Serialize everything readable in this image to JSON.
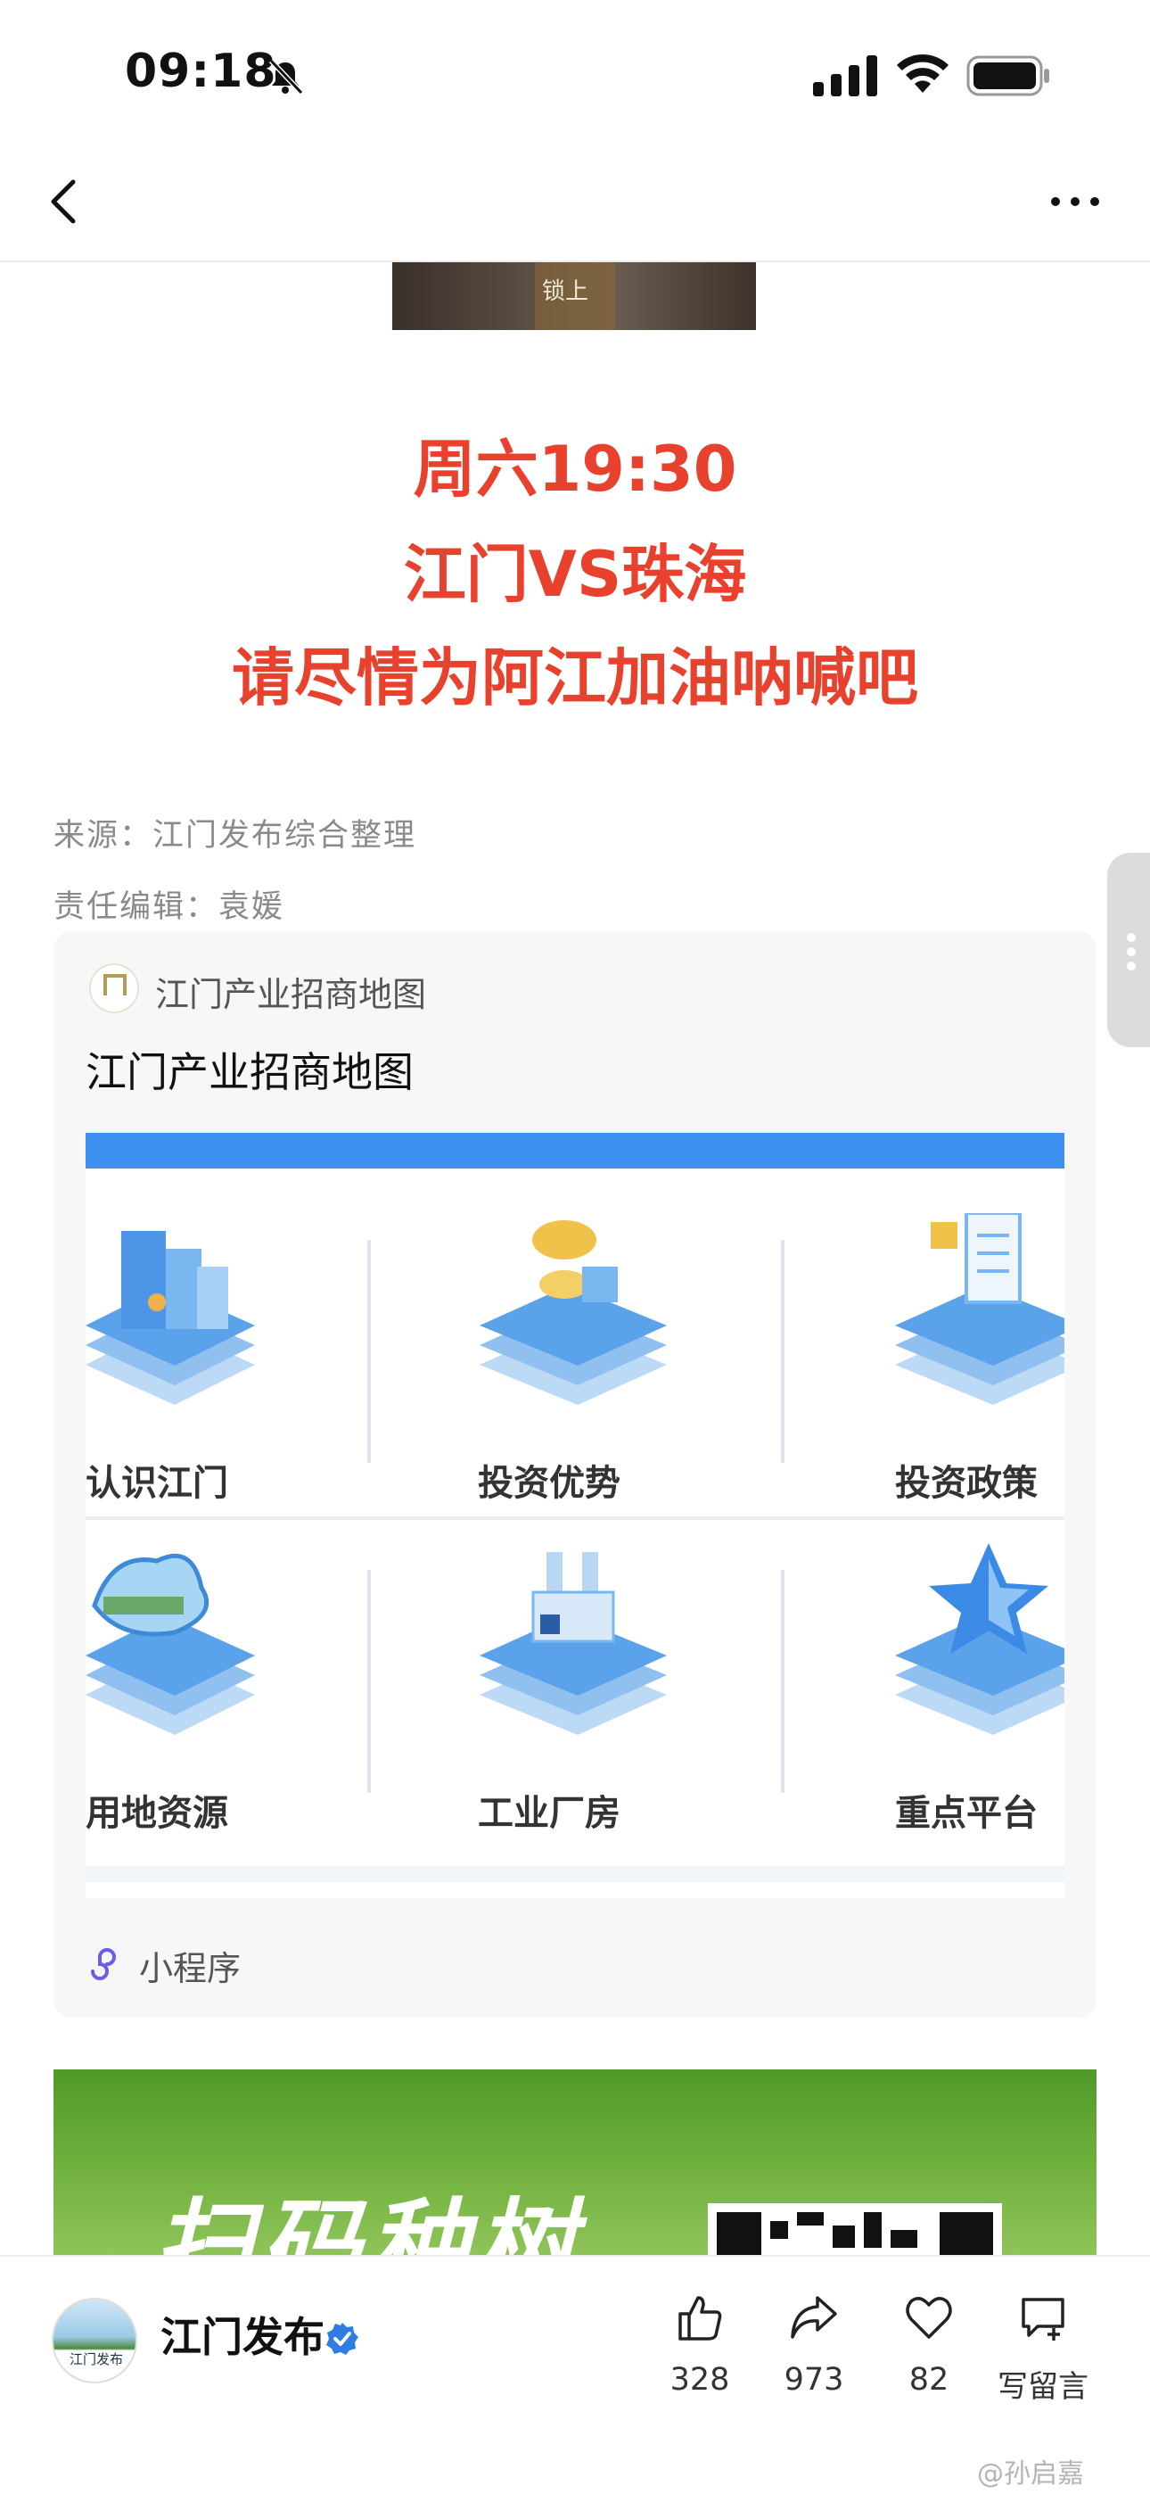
{
  "status_bar": {
    "time": "09:18",
    "icons": [
      "bell-slash-icon",
      "signal-icon",
      "wifi-icon",
      "battery-icon"
    ]
  },
  "nav": {
    "back_icon": "chevron-left-icon",
    "more_icon": "more-horizontal-icon"
  },
  "top_image": {
    "label": "锁上"
  },
  "headline": {
    "line1": "周六19:30",
    "line2": "江门VS珠海",
    "line3": "请尽情为阿江加油呐喊吧",
    "color": "#e8412d"
  },
  "meta": {
    "source": "来源：江门发布综合整理",
    "editor": "责任编辑：袁媛"
  },
  "mini_program": {
    "source_name": "江门产业招商地图",
    "title": "江门产业招商地图",
    "tiles": [
      {
        "label": "认识江门",
        "icon": "buildings-icon"
      },
      {
        "label": "投资优势",
        "icon": "coins-icon"
      },
      {
        "label": "投资政策",
        "icon": "document-icon"
      },
      {
        "label": "用地资源",
        "icon": "land-map-icon"
      },
      {
        "label": "工业厂房",
        "icon": "factory-icon"
      },
      {
        "label": "重点平台",
        "icon": "star-icon"
      }
    ],
    "footer_label": "小程序",
    "accent": "#3d8ff0"
  },
  "bottom_bar": {
    "avatar_text": "江门发布",
    "account_name": "江门发布",
    "actions": {
      "like": "328",
      "share": "973",
      "favorite": "82",
      "comment": "写留言"
    },
    "verified_color": "#2f7de1"
  },
  "watermark": "@孙启嘉"
}
